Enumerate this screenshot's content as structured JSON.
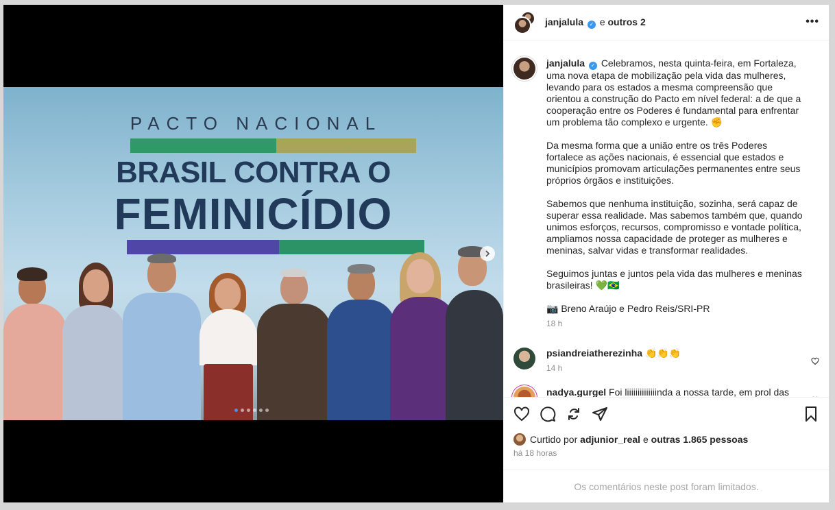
{
  "media": {
    "banner_line0": "PACTO NACIONAL",
    "banner_line1": "BRASIL CONTRA O",
    "banner_line2": "FEMINICÍDIO",
    "carousel_count": 6,
    "carousel_active": 0
  },
  "header": {
    "username": "janjalula",
    "connector": "e",
    "others": "outros 2",
    "more": "•••"
  },
  "caption": {
    "username": "janjalula",
    "p1": "Celebramos, nesta quinta-feira, em Fortaleza, uma nova etapa de mobilização pela vida das mulheres, levando para os estados a mesma compreensão que orientou a construção do Pacto em nível federal: a de que a cooperação entre os Poderes é fundamental para enfrentar um problema tão complexo e urgente. ✊",
    "p2": "Da mesma forma que a união entre os três Poderes fortalece as ações nacionais, é essencial que estados e municípios promovam articulações permanentes entre seus próprios órgãos e instituições.",
    "p3": "Sabemos que nenhuma instituição, sozinha, será capaz de superar essa realidade. Mas sabemos também que, quando unimos esforços, recursos, compromisso e vontade política, ampliamos nossa capacidade de proteger as mulheres e meninas, salvar vidas e transformar realidades.",
    "p4": "Seguimos juntas e juntos pela vida das mulheres e meninas brasileiras! 💚🇧🇷",
    "p5": "📷 Breno Araújo e Pedro Reis/SRI-PR",
    "time": "18 h"
  },
  "comments": [
    {
      "username": "psiandreiatherezinha",
      "text": "👏👏👏",
      "time": "14 h"
    },
    {
      "username": "nadya.gurgel",
      "text": "Foi liiiiiiiiiiiiiinda a nossa tarde, em prol das",
      "time": ""
    }
  ],
  "likes": {
    "prefix": "Curtido por",
    "user": "adjunior_real",
    "connector": "e",
    "others": "outras 1.865 pessoas",
    "ago": "há 18 horas"
  },
  "footer": {
    "limited": "Os comentários neste post foram limitados."
  },
  "colors": {
    "verified": "#3897f0",
    "banner_text": "#213a5a",
    "green": "#2f9a67",
    "purple": "#4f46a8",
    "gold": "#a9a558"
  }
}
